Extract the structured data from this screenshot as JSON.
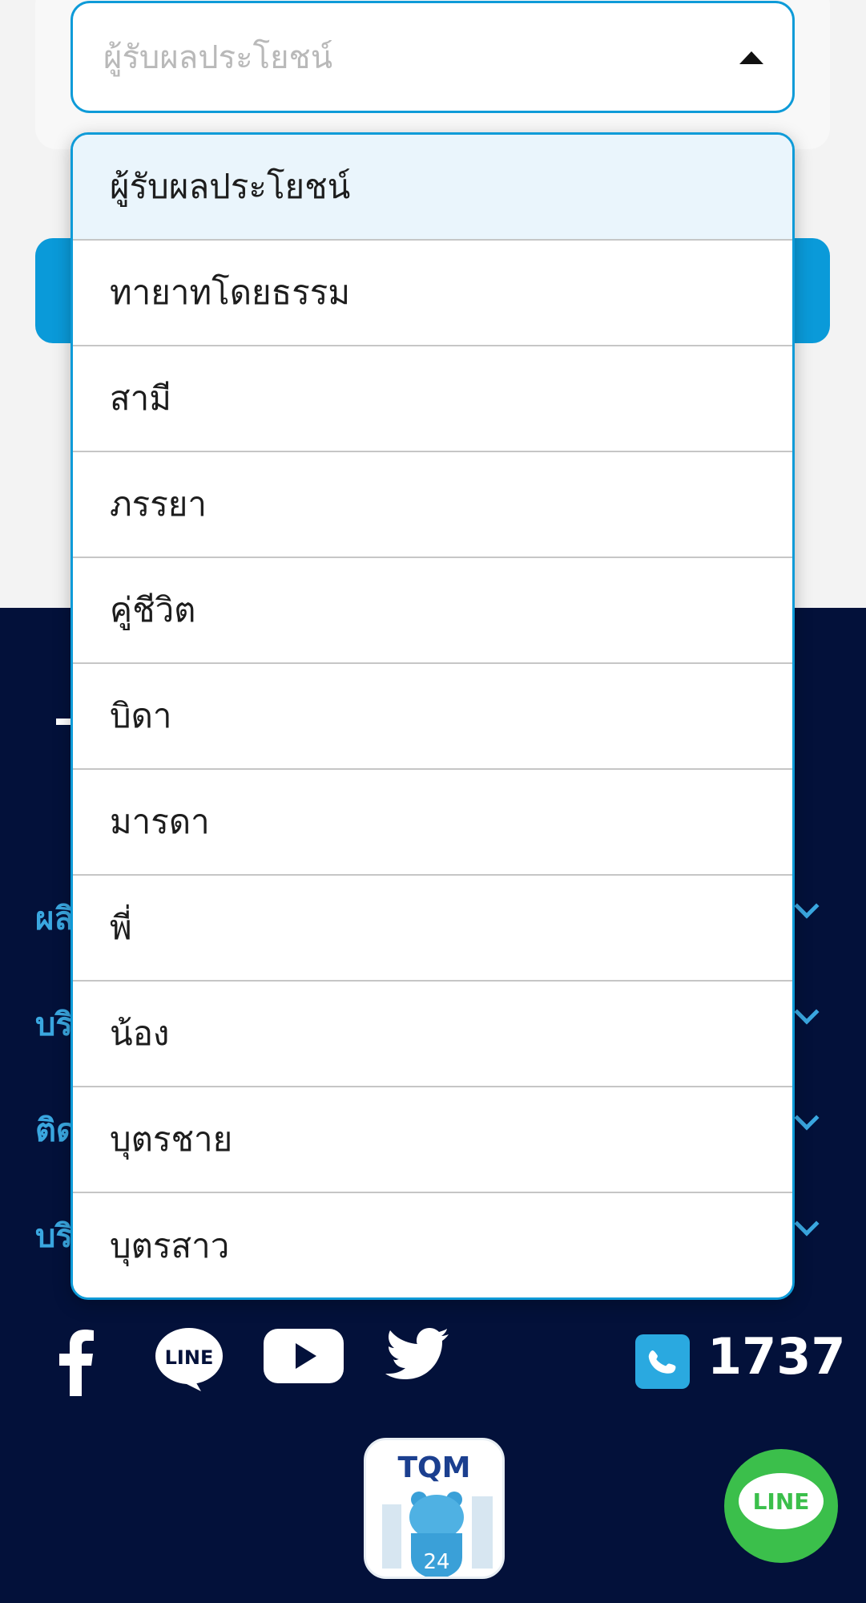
{
  "select": {
    "placeholder": "ผู้รับผลประโยชน์"
  },
  "dropdown": {
    "options": [
      "ผู้รับผลประโยชน์",
      "ทายาทโดยธรรม",
      "สามี",
      "ภรรยา",
      "คู่ชีวิต",
      "บิดา",
      "มารดา",
      "พี่",
      "น้อง",
      "บุตรชาย",
      "บุตรสาว"
    ],
    "selected_index": 0
  },
  "footer": {
    "accordion": [
      {
        "label": "ผลิ"
      },
      {
        "label": "บริ"
      },
      {
        "label": "ติด"
      },
      {
        "label": "บริ"
      }
    ],
    "phone_number": "1737",
    "app_brand": "TQM",
    "app_badge_number": "24",
    "line_label": "LINE",
    "line_fab_label": "LINE"
  },
  "colors": {
    "accent": "#0e9bd8",
    "footer_bg": "#03113a",
    "link_blue": "#3aa7e0",
    "line_green": "#3bbf4b"
  }
}
